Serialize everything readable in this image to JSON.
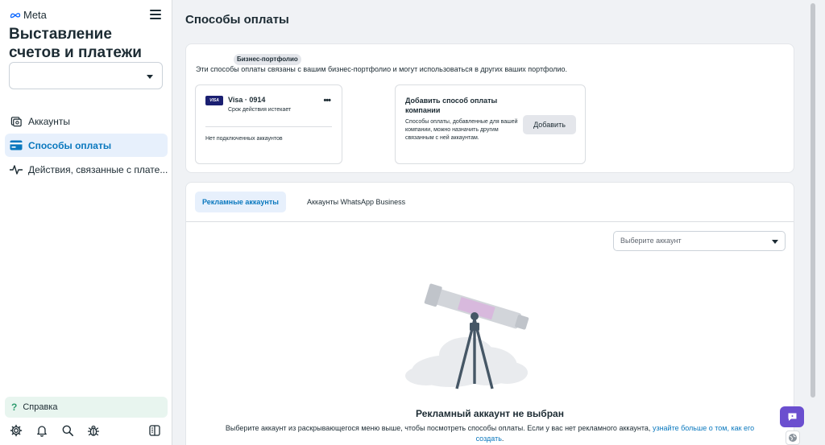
{
  "brand": {
    "name": "Meta",
    "logo_icon": "meta-infinity-icon"
  },
  "sidebar": {
    "title": "Выставление счетов и платежи",
    "business_select_value": "",
    "items": [
      {
        "label": "Аккаунты",
        "icon": "accounts-icon",
        "active": false
      },
      {
        "label": "Способы оплаты",
        "icon": "credit-card-icon",
        "active": true
      },
      {
        "label": "Действия, связанные с плате...",
        "icon": "activity-pulse-icon",
        "active": false
      }
    ],
    "help_label": "Справка",
    "bottom_icons": [
      "gear-icon",
      "bell-icon",
      "search-icon",
      "bug-icon",
      "panel-toggle-icon"
    ]
  },
  "main": {
    "page_title": "Способы оплаты",
    "business_card": {
      "badge": "Бизнес-портфолио",
      "description": "Эти способы оплаты связаны с вашим бизнес-портфолио и могут использоваться в других ваших портфолио.",
      "payment_method": {
        "brand_logo": "VISA",
        "name": "Visa · 0914",
        "status": "Срок действия истекает",
        "linked_accounts": "Нет подключенных аккаунтов"
      },
      "add_method": {
        "title": "Добавить способ оплаты компании",
        "description": "Способы оплаты, добавленные для вашей компании, можно назначить другим связанным с ней аккаунтам.",
        "button_label": "Добавить"
      }
    },
    "tabs": [
      {
        "label": "Рекламные аккаунты",
        "active": true
      },
      {
        "label": "Аккаунты WhatsApp Business",
        "active": false
      }
    ],
    "account_select_placeholder": "Выберите аккаунт",
    "empty_state": {
      "title": "Рекламный аккаунт не выбран",
      "description": "Выберите аккаунт из раскрывающегося меню выше, чтобы посмотреть способы оплаты. Если у вас нет рекламного аккаунта,",
      "link_text": "узнайте больше о том, как его создать",
      "link_suffix": "."
    }
  },
  "colors": {
    "accent": "#0a78be",
    "active_bg": "#e7f0fc",
    "help_bg": "#e8f5ef",
    "chat_button": "#6b4fcf"
  }
}
